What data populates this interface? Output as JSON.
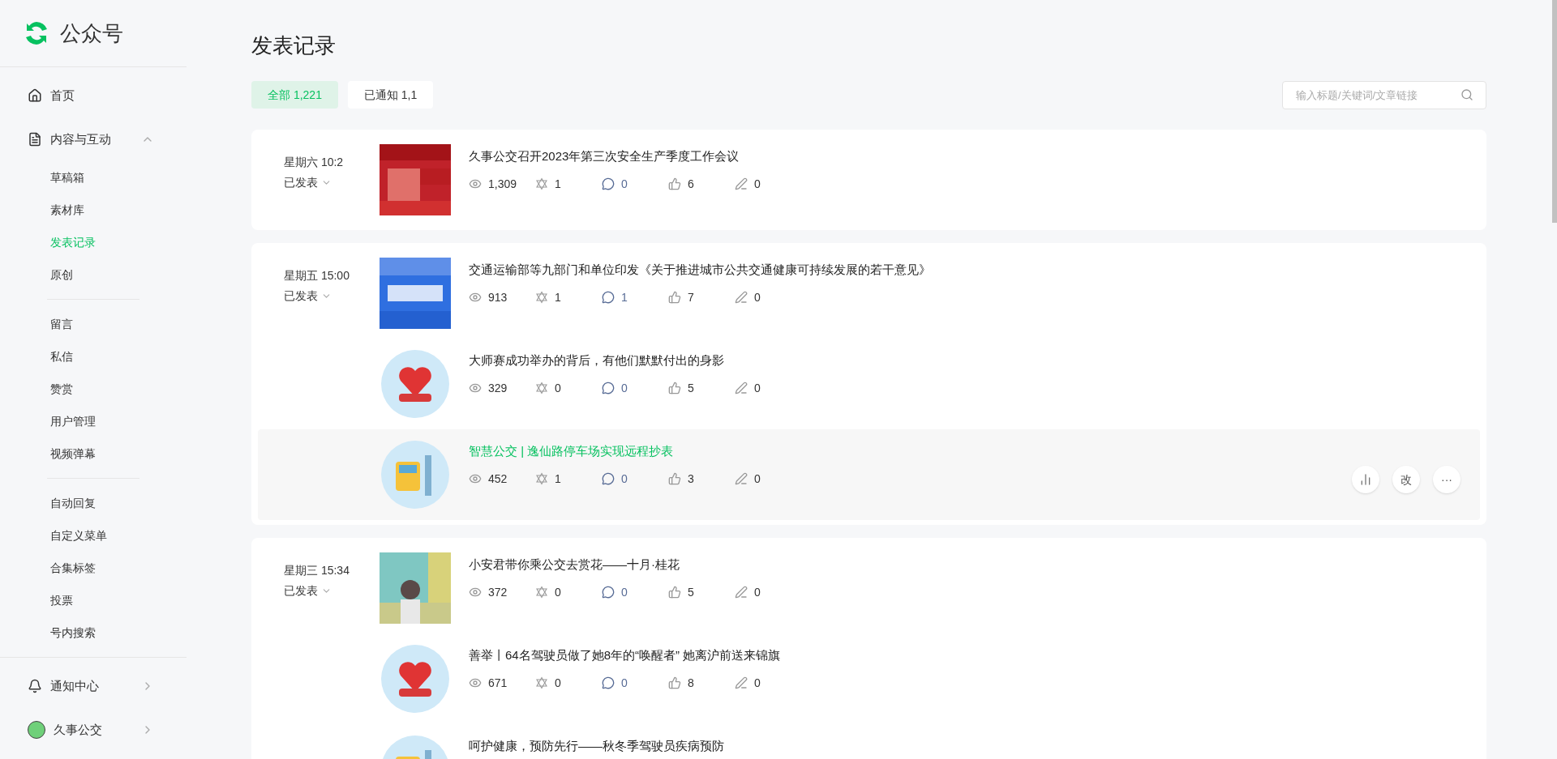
{
  "brand": {
    "name": "公众号"
  },
  "sidebar": {
    "items": [
      {
        "kind": "home",
        "label": "首页"
      },
      {
        "kind": "section",
        "label": "内容与互动",
        "expanded": true,
        "groups": [
          [
            {
              "label": "草稿箱",
              "selected": false
            },
            {
              "label": "素材库",
              "selected": false
            },
            {
              "label": "发表记录",
              "selected": true
            },
            {
              "label": "原创",
              "selected": false
            }
          ],
          [
            {
              "label": "留言",
              "selected": false
            },
            {
              "label": "私信",
              "selected": false
            },
            {
              "label": "赞赏",
              "selected": false
            },
            {
              "label": "用户管理",
              "selected": false
            },
            {
              "label": "视频弹幕",
              "selected": false
            }
          ],
          [
            {
              "label": "自动回复",
              "selected": false
            },
            {
              "label": "自定义菜单",
              "selected": false
            },
            {
              "label": "合集标签",
              "selected": false
            },
            {
              "label": "投票",
              "selected": false
            },
            {
              "label": "号内搜索",
              "selected": false
            }
          ]
        ]
      },
      {
        "kind": "notice",
        "label": "通知中心"
      },
      {
        "kind": "account",
        "label": "久事公交"
      }
    ]
  },
  "page_title": "发表记录",
  "tabs": [
    {
      "label": "全部 1,221",
      "selected": true
    },
    {
      "label": "已通知 1,1",
      "selected": false
    }
  ],
  "search": {
    "placeholder": "输入标题/关键词/文章链接"
  },
  "hover_actions": [
    {
      "kind": "chart"
    },
    {
      "kind": "text",
      "label": "改"
    },
    {
      "kind": "text",
      "label": "···"
    }
  ],
  "groups": [
    {
      "time": "星期六 10:2",
      "status": "已发表",
      "articles": [
        {
          "title": "久事公交召开2023年第三次安全生产季度工作会议",
          "highlighted": false,
          "views": "1,309",
          "shares": "1",
          "comments": "0",
          "likes": "6",
          "edits": "0"
        }
      ]
    },
    {
      "time": "星期五 15:00",
      "status": "已发表",
      "articles": [
        {
          "title": "交通运输部等九部门和单位印发《关于推进城市公共交通健康可持续发展的若干意见》",
          "highlighted": false,
          "views": "913",
          "shares": "1",
          "comments": "1",
          "likes": "7",
          "edits": "0"
        },
        {
          "title": "大师赛成功举办的背后，有他们默默付出的身影",
          "highlighted": false,
          "views": "329",
          "shares": "0",
          "comments": "0",
          "likes": "5",
          "edits": "0"
        },
        {
          "title": "智慧公交 | 逸仙路停车场实现远程抄表",
          "highlighted": true,
          "views": "452",
          "shares": "1",
          "comments": "0",
          "likes": "3",
          "edits": "0"
        }
      ]
    },
    {
      "time": "星期三 15:34",
      "status": "已发表",
      "articles": [
        {
          "title": "小安君带你乘公交去赏花——十月·桂花",
          "highlighted": false,
          "views": "372",
          "shares": "0",
          "comments": "0",
          "likes": "5",
          "edits": "0"
        },
        {
          "title": "善举丨64名驾驶员做了她8年的“唤醒者” 她离沪前送来锦旗",
          "highlighted": false,
          "views": "671",
          "shares": "0",
          "comments": "0",
          "likes": "8",
          "edits": "0"
        },
        {
          "title": "呵护健康，预防先行——秋冬季驾驶员疾病预防"
        }
      ]
    }
  ]
}
